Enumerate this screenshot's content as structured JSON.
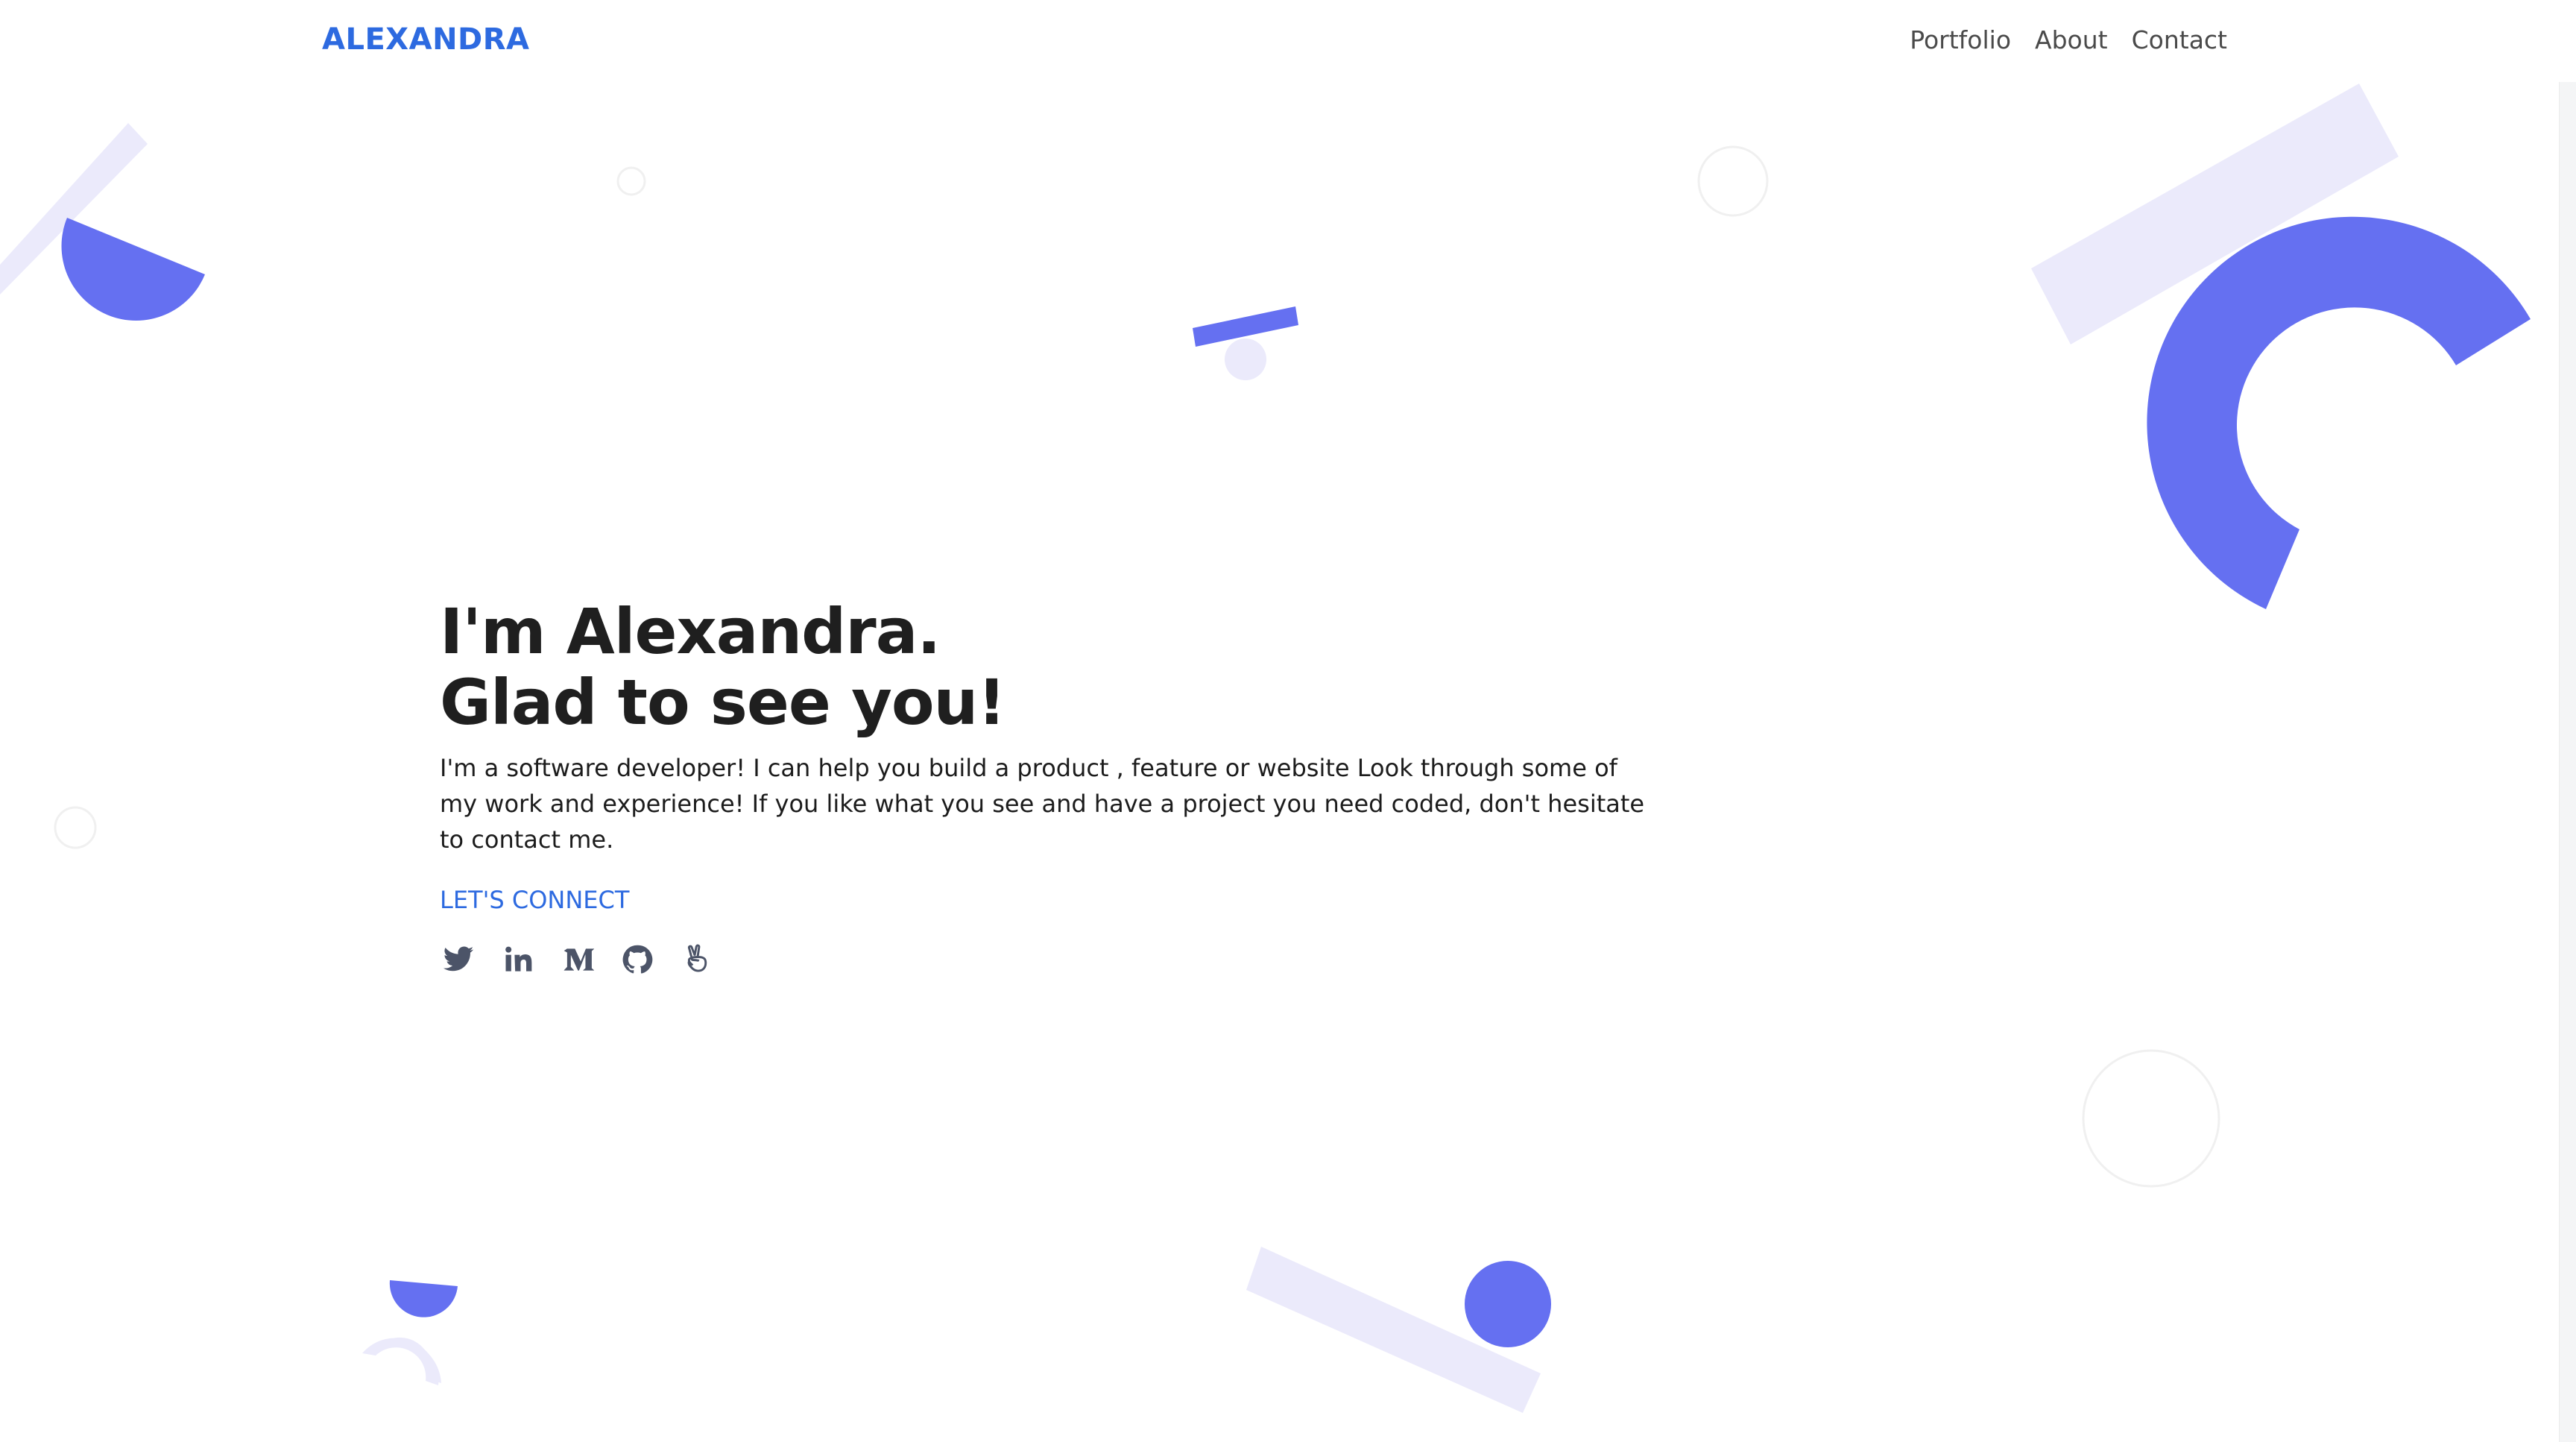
{
  "nav": {
    "brand": "ALEXANDRA",
    "links": [
      {
        "label": "Portfolio"
      },
      {
        "label": "About"
      },
      {
        "label": "Contact"
      }
    ]
  },
  "hero": {
    "title_line1": "I'm Alexandra.",
    "title_line2": "Glad to see you!",
    "description": "I'm a software developer! I can help you build a product , feature or website Look through some of my work and experience! If you like what you see and have a project you need coded, don't hesitate to contact me.",
    "cta_label": "LET'S CONNECT"
  },
  "social_icons": [
    {
      "name": "twitter-icon"
    },
    {
      "name": "linkedin-icon"
    },
    {
      "name": "medium-icon"
    },
    {
      "name": "github-icon"
    },
    {
      "name": "angellist-icon"
    }
  ],
  "colors": {
    "accent_blue": "#2d6ae0",
    "shape_primary": "#6570f1",
    "shape_light": "#ebeafb",
    "text_dark": "#1f1f1f",
    "icon_gray": "#4c5468"
  }
}
